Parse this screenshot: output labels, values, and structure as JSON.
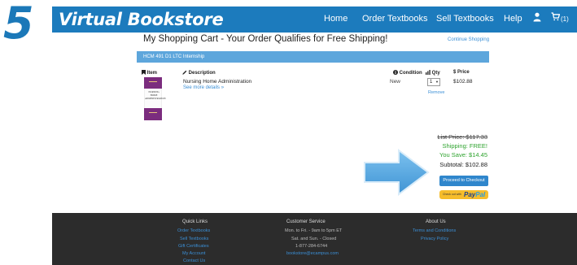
{
  "step_number": "5",
  "navbar": {
    "brand": "Virtual Bookstore",
    "links": [
      "Home",
      "Order Textbooks",
      "Sell Textbooks",
      "Help"
    ],
    "cart_count": "(1)",
    "icons": [
      "user-icon",
      "cart-icon"
    ]
  },
  "cart": {
    "title": "My Shopping Cart - Your Order Qualifies for Free Shipping!",
    "continue_shopping": "Continue Shopping",
    "course": "HCM 491 D1 LTC Internship",
    "headers": {
      "item": "Item",
      "description": "Description",
      "condition": "Condition",
      "qty": "Qty",
      "price": "$ Price"
    },
    "item": {
      "title": "Nursing Home Administration",
      "see_more": "See more details »",
      "cover_text": "NURSING HOME ADMINISTRATION",
      "condition": "New",
      "qty": "1",
      "remove": "Remove",
      "price": "$102.88"
    }
  },
  "summary": {
    "list_price": "List Price: $117.33",
    "shipping": "Shipping: FREE!",
    "you_save": "You Save: $14.45",
    "subtotal": "Subtotal: $102.88",
    "checkout": "Proceed to Checkout",
    "paypal_prefix": "Check out with",
    "paypal_pay": "Pay",
    "paypal_pal": "Pal"
  },
  "footer": {
    "quick_links": {
      "heading": "Quick Links",
      "items": [
        "Order Textbooks",
        "Sell Textbooks",
        "Gift Certificates",
        "My Account",
        "Contact Us"
      ]
    },
    "customer_service": {
      "heading": "Customer Service",
      "lines": [
        "Mon. to Fri. - 9am to 5pm ET",
        "Sat. and Sun. - Closed",
        "1-877-284-6744"
      ],
      "email": "bookstore@ecampus.com"
    },
    "about": {
      "heading": "About Us",
      "items": [
        "Terms and Conditions",
        "Privacy Policy"
      ]
    }
  },
  "colors": {
    "nav_blue": "#1c7bbd",
    "accent_blue": "#3b8fd6",
    "free_green": "#2ea32e",
    "footer_dark": "#2c2c2c",
    "paypal_yellow": "#f6bd2b"
  }
}
